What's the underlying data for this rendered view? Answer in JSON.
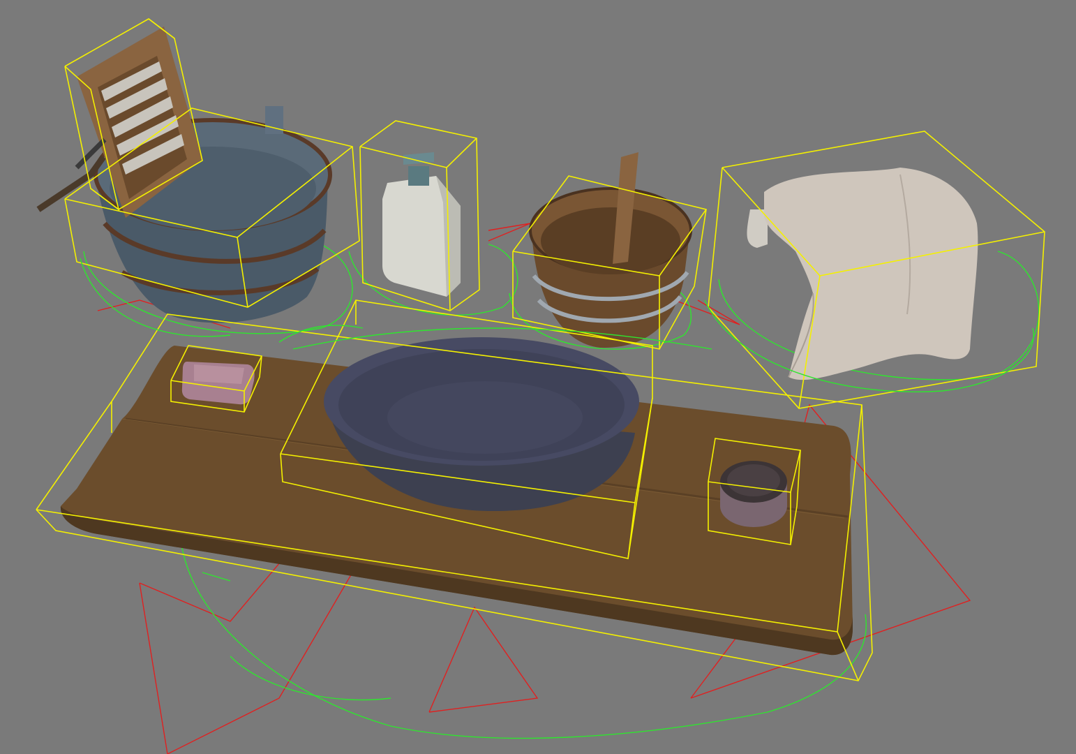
{
  "viewport": {
    "background": "#7a7a7a",
    "bbox_color": "#f4f000",
    "light_gizmo_color": "#e02020",
    "collision_color": "#2ee62e"
  },
  "scene_objects": [
    "wash-tub",
    "washboard",
    "soap-dispenser",
    "wooden-bucket",
    "stool-with-cloth",
    "wooden-plank-table",
    "metal-basin",
    "soap-bar",
    "tin-can"
  ]
}
